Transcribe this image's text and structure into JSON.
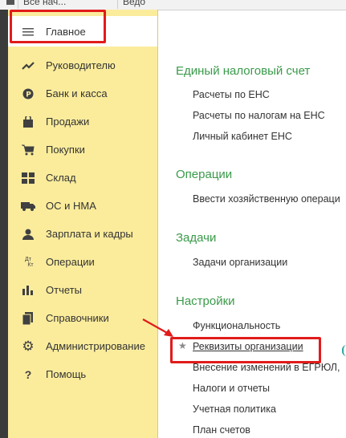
{
  "tabs": [
    "Все нач...",
    "Ведо"
  ],
  "sidebar": {
    "items": [
      {
        "label": "Главное",
        "icon": "menu-icon"
      },
      {
        "label": "Руководителю",
        "icon": "trend-icon"
      },
      {
        "label": "Банк и касса",
        "icon": "ruble-coin-icon"
      },
      {
        "label": "Продажи",
        "icon": "shopping-bag-icon"
      },
      {
        "label": "Покупки",
        "icon": "cart-icon"
      },
      {
        "label": "Склад",
        "icon": "warehouse-grid-icon"
      },
      {
        "label": "ОС и НМА",
        "icon": "truck-icon"
      },
      {
        "label": "Зарплата и кадры",
        "icon": "person-icon"
      },
      {
        "label": "Операции",
        "icon": "dt-kt-icon"
      },
      {
        "label": "Отчеты",
        "icon": "bar-chart-icon"
      },
      {
        "label": "Справочники",
        "icon": "book-icon"
      },
      {
        "label": "Администрирование",
        "icon": "gear-icon"
      },
      {
        "label": "Помощь",
        "icon": "question-icon"
      }
    ]
  },
  "content": {
    "sections": [
      {
        "title": "Единый налоговый счет",
        "links": [
          "Расчеты по ЕНС",
          "Расчеты по налогам на ЕНС",
          "Личный кабинет ЕНС"
        ]
      },
      {
        "title": "Операции",
        "links": [
          "Ввести хозяйственную операци"
        ]
      },
      {
        "title": "Задачи",
        "links": [
          "Задачи организации"
        ]
      },
      {
        "title": "Настройки",
        "links": [
          "Функциональность",
          "Реквизиты организации",
          "Внесение изменений в ЕГРЮЛ,",
          "Налоги и отчеты",
          "Учетная политика",
          "План счетов"
        ]
      }
    ]
  },
  "colors": {
    "sidebar_bg": "#fbec9c",
    "section_title": "#3a9a4a",
    "highlight": "#e21b1b"
  },
  "icons": {
    "dt_kt_top": "Дт",
    "dt_kt_bottom": "Кт",
    "question": "?",
    "star": "★"
  }
}
